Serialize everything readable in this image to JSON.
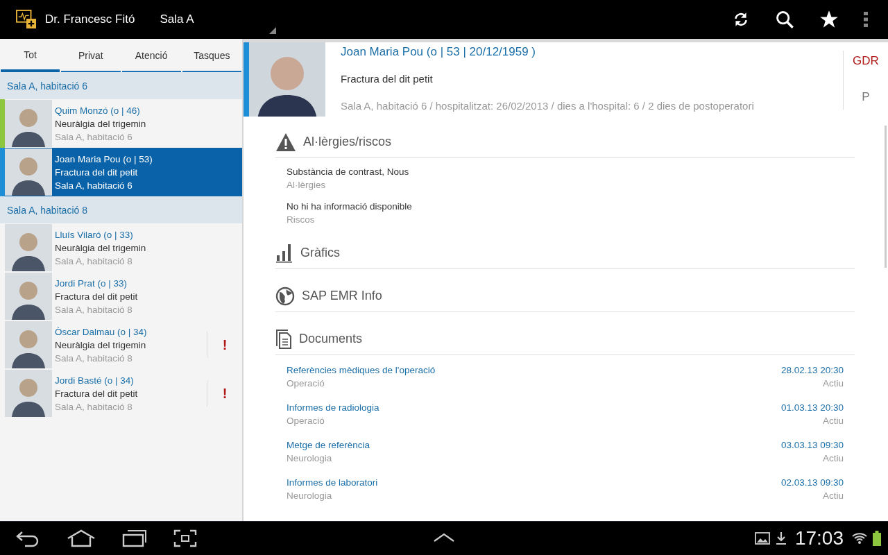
{
  "action_bar": {
    "title": "Dr. Francesc Fitó",
    "location": "Sala A"
  },
  "tabs": [
    {
      "label": "Tot",
      "selected": true
    },
    {
      "label": "Privat",
      "selected": false
    },
    {
      "label": "Atenció",
      "selected": false
    },
    {
      "label": "Tasques",
      "selected": false
    }
  ],
  "patient_groups": [
    {
      "header": "Sala A, habitació 6",
      "patients": [
        {
          "name": "Quim Monzó (o | 46)",
          "diagnosis": "Neuràlgia del trigemin",
          "room": "Sala A, habitació 6",
          "selected": false,
          "color": "#8dc63f"
        },
        {
          "name": "Joan Maria Pou (o | 53)",
          "diagnosis": "Fractura del dit petit",
          "room": "Sala A, habitació 6",
          "selected": true,
          "color": "#1e8fd6"
        }
      ]
    },
    {
      "header": "Sala A, habitació 8",
      "patients": [
        {
          "name": "Lluís Vilaró (o | 33)",
          "diagnosis": "Neuràlgia del trigemin",
          "room": "Sala A, habitació 8",
          "selected": false
        },
        {
          "name": "Jordi Prat (o | 33)",
          "diagnosis": "Fractura del dit petit",
          "room": "Sala A, habitació 8",
          "selected": false
        },
        {
          "name": "Òscar Dalmau (o | 34)",
          "diagnosis": "Neuràlgia del trigemin",
          "room": "Sala A, habitació 8",
          "selected": false,
          "alert": "!"
        },
        {
          "name": "Jordi Basté (o | 34)",
          "diagnosis": "Fractura del dit petit",
          "room": "Sala A, habitació 8",
          "selected": false,
          "alert": "!"
        }
      ]
    }
  ],
  "patient_detail": {
    "name": "Joan Maria Pou (o | 53 | 20/12/1959 )",
    "diagnosis": "Fractura del dit petit",
    "info": "Sala A, habitació 6 / hospitalitzat: 26/02/2013 / dies a l'hospital: 6 / 2 dies de postoperatori",
    "side_labels": [
      "GDR",
      "P"
    ]
  },
  "sections": [
    {
      "kind": "warning",
      "title": "Al·lèrgies/riscos",
      "items": [
        {
          "value": "Substància de contrast, Nous",
          "label": "Al·lèrgies"
        },
        {
          "value": "No hi ha informació disponible",
          "label": "Riscos"
        }
      ]
    },
    {
      "kind": "chart",
      "title": "Gràfics"
    },
    {
      "kind": "globe",
      "title": "SAP EMR Info"
    },
    {
      "kind": "documents",
      "title": "Documents",
      "documents": [
        {
          "title": "Referències mèdiques de l'operació",
          "category": "Operació",
          "date": "28.02.13 20:30",
          "status": "Actiu"
        },
        {
          "title": "Informes de radiologia",
          "category": "Operació",
          "date": "01.03.13 20:30",
          "status": "Actiu"
        },
        {
          "title": "Metge de referència",
          "category": "Neurologia",
          "date": "03.03.13 09:30",
          "status": "Actiu"
        },
        {
          "title": "Informes de laboratori",
          "category": "Neurologia",
          "date": "02.03.13 09:30",
          "status": "Actiu"
        }
      ]
    }
  ],
  "system_bar": {
    "time": "17:03"
  }
}
